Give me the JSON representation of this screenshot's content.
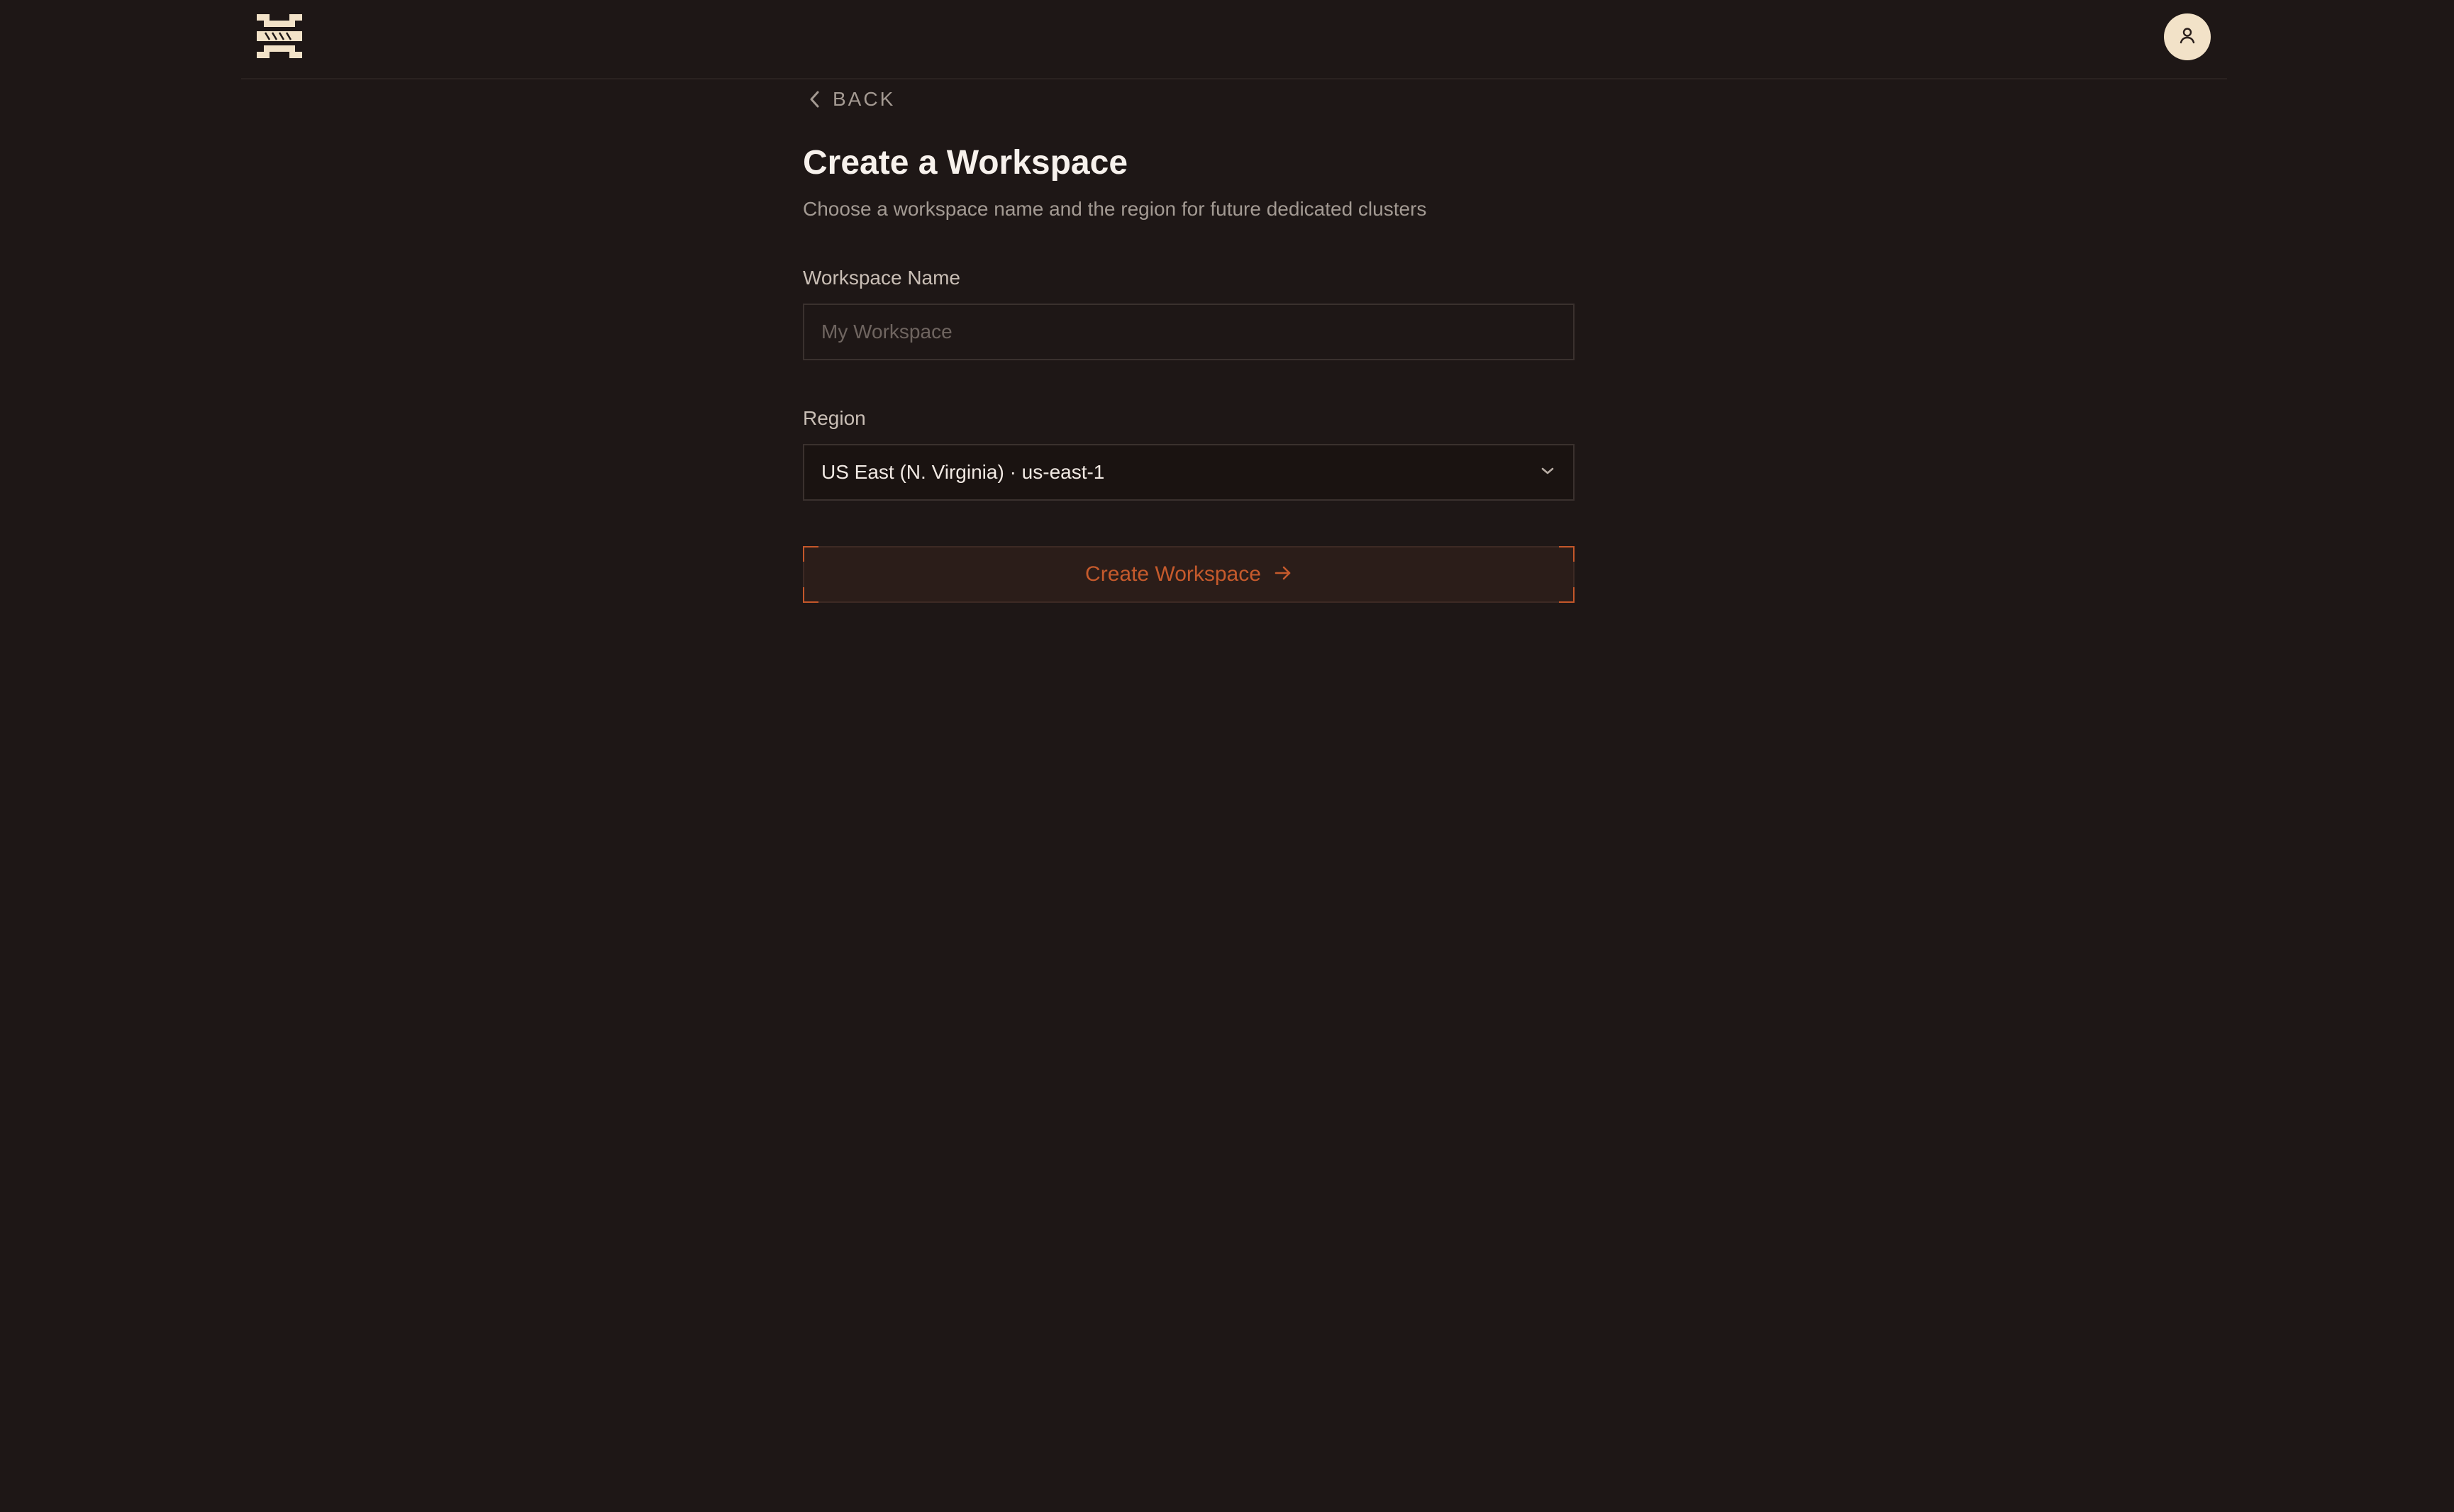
{
  "header": {
    "logo_icon": "brand-logo-icon",
    "avatar_icon": "user-icon"
  },
  "back": {
    "label": "BACK",
    "icon": "chevron-left-icon"
  },
  "page": {
    "title": "Create a Workspace",
    "subtitle": "Choose a workspace name and the region for future dedicated clusters"
  },
  "form": {
    "workspace_name": {
      "label": "Workspace Name",
      "value": "",
      "placeholder": "My Workspace"
    },
    "region": {
      "label": "Region",
      "selected": "US East (N. Virginia) · us-east-1",
      "icon": "chevron-down-icon"
    },
    "submit": {
      "label": "Create Workspace",
      "icon": "arrow-right-icon"
    }
  },
  "colors": {
    "background": "#1e1716",
    "accent": "#c55a2c",
    "avatar_bg": "#f2e2c8",
    "logo": "#f2e2c8"
  }
}
